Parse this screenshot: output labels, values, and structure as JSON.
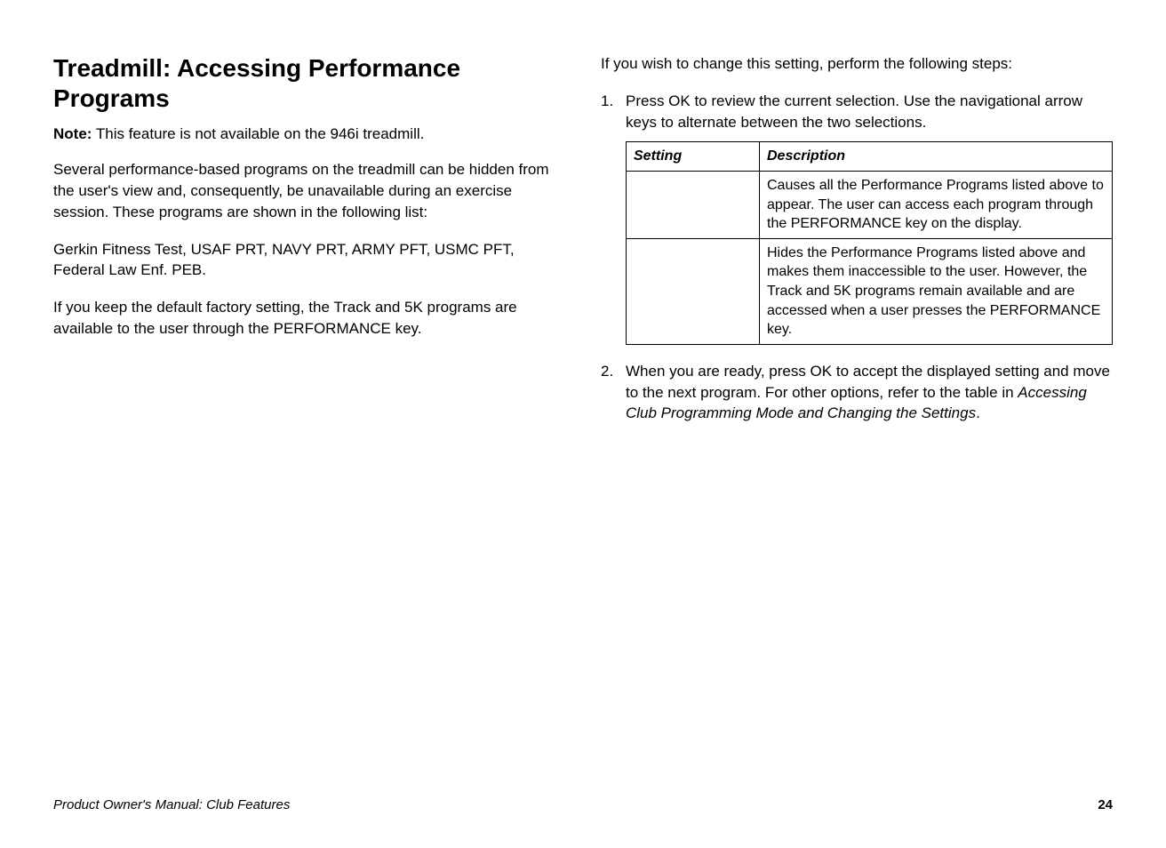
{
  "heading": "Treadmill: Accessing Performance Programs",
  "note_label": "Note:",
  "note_text": " This feature is not available on the 946i treadmill.",
  "para1": "Several performance-based programs on the treadmill can be hidden from the user's view and, consequently, be unavailable during an exercise session. These programs are shown in the following list:",
  "para2": "Gerkin Fitness Test, USAF PRT, NAVY PRT, ARMY PFT, USMC PFT, Federal Law Enf. PEB.",
  "para3": "If you keep the default factory setting, the Track and 5K programs are available to the user through the PERFORMANCE key.",
  "right_intro": "If you wish to change this setting, perform the following steps:",
  "step1_num": "1.",
  "step1_a": "Press OK to review the current ",
  "step1_b": " selection. Use the navigational arrow keys to alternate between the two selections.",
  "table": {
    "h1": "Setting",
    "h2": "Description",
    "r1c1": "",
    "r1c2": "Causes all the Performance Programs listed above to appear. The user can access each program through the PERFORMANCE key on the display.",
    "r2c1": "",
    "r2c2": "Hides the Performance Programs listed above and makes them inaccessible to the user. However, the Track and 5K programs remain available and are accessed when a user presses the PERFORMANCE key."
  },
  "step2_num": "2.",
  "step2_a": "When you are ready, press OK to accept the displayed setting and move to the next program. For other options, refer to the table in ",
  "step2_italic": "Accessing Club Programming Mode and Changing the Settings",
  "step2_c": ".",
  "footer_left": "Product Owner's Manual: Club Features",
  "footer_right": "24"
}
